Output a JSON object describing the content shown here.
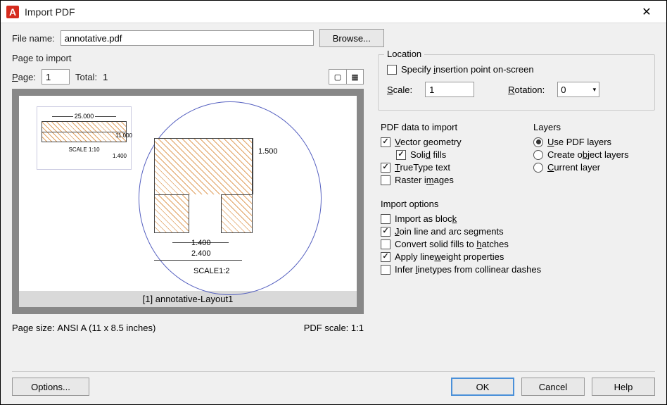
{
  "window": {
    "title": "Import PDF",
    "app_icon_letter": "A"
  },
  "filename": {
    "label": "File name:",
    "value": "annotative.pdf",
    "browse_label": "Browse..."
  },
  "page_to_import": {
    "title": "Page to import",
    "page_label": "Page:",
    "page_value": "1",
    "total_label": "Total:",
    "total_value": "1"
  },
  "preview": {
    "caption": "[1] annotative-Layout1",
    "sub_dim_top": "25.000",
    "sub_dim_side": "11.000",
    "sub_scale": "SCALE 1:10",
    "sub_dim_bottom": "1.400",
    "main_dim_v": "1.500",
    "main_dim_h1": "1.400",
    "main_dim_h2": "2.400",
    "main_scale": "SCALE1:2"
  },
  "page_info": {
    "size_label": "Page size:",
    "size_value": "ANSI A (11 x 8.5 inches)",
    "scale_label": "PDF scale:",
    "scale_value": "1:1"
  },
  "location": {
    "title": "Location",
    "specify_label": "Specify insertion point on-screen",
    "scale_label": "Scale:",
    "scale_value": "1",
    "rotation_label": "Rotation:",
    "rotation_value": "0"
  },
  "pdf_data": {
    "title": "PDF data to import",
    "vector": "Vector geometry",
    "solid": "Solid fills",
    "truetype": "TrueType text",
    "raster": "Raster images"
  },
  "layers": {
    "title": "Layers",
    "use_pdf": "Use PDF layers",
    "create_obj": "Create object layers",
    "current": "Current layer"
  },
  "import_options": {
    "title": "Import options",
    "as_block": "Import as block",
    "join": "Join line and arc segments",
    "convert": "Convert solid fills to hatches",
    "lineweight": "Apply lineweight properties",
    "infer": "Infer linetypes from collinear dashes"
  },
  "footer": {
    "options": "Options...",
    "ok": "OK",
    "cancel": "Cancel",
    "help": "Help"
  }
}
